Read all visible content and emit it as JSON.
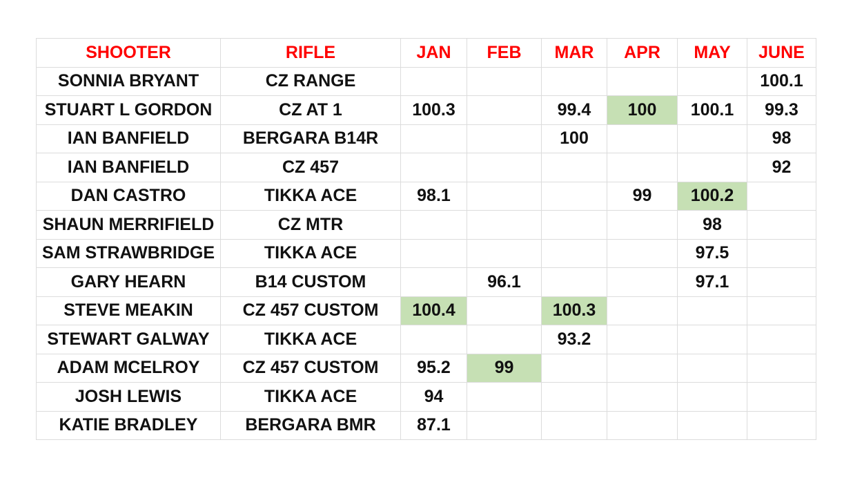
{
  "colors": {
    "header_text": "#ff0000",
    "highlight": "#c6e0b4",
    "grid": "#dcdcdc"
  },
  "headers": [
    "SHOOTER",
    "RIFLE",
    "JAN",
    "FEB",
    "MAR",
    "APR",
    "MAY",
    "JUNE"
  ],
  "rows": [
    {
      "shooter": "SONNIA BRYANT",
      "rifle": "CZ RANGE",
      "scores": [
        "",
        "",
        "",
        "",
        "",
        "100.1"
      ],
      "highlight": []
    },
    {
      "shooter": "STUART L GORDON",
      "rifle": "CZ AT 1",
      "scores": [
        "100.3",
        "",
        "99.4",
        "100",
        "100.1",
        "99.3"
      ],
      "highlight": [
        3
      ]
    },
    {
      "shooter": "IAN BANFIELD",
      "rifle": "BERGARA B14R",
      "scores": [
        "",
        "",
        "100",
        "",
        "",
        "98"
      ],
      "highlight": []
    },
    {
      "shooter": "IAN BANFIELD",
      "rifle": "CZ 457",
      "scores": [
        "",
        "",
        "",
        "",
        "",
        "92"
      ],
      "highlight": []
    },
    {
      "shooter": "DAN CASTRO",
      "rifle": "TIKKA ACE",
      "scores": [
        "98.1",
        "",
        "",
        "99",
        "100.2",
        ""
      ],
      "highlight": [
        4
      ]
    },
    {
      "shooter": "SHAUN MERRIFIELD",
      "rifle": "CZ MTR",
      "scores": [
        "",
        "",
        "",
        "",
        "98",
        ""
      ],
      "highlight": []
    },
    {
      "shooter": "SAM STRAWBRIDGE",
      "rifle": "TIKKA ACE",
      "scores": [
        "",
        "",
        "",
        "",
        "97.5",
        ""
      ],
      "highlight": []
    },
    {
      "shooter": "GARY HEARN",
      "rifle": "B14 CUSTOM",
      "scores": [
        "",
        "96.1",
        "",
        "",
        "97.1",
        ""
      ],
      "highlight": []
    },
    {
      "shooter": "STEVE MEAKIN",
      "rifle": "CZ 457 CUSTOM",
      "scores": [
        "100.4",
        "",
        "100.3",
        "",
        "",
        ""
      ],
      "highlight": [
        0,
        2
      ]
    },
    {
      "shooter": "STEWART GALWAY",
      "rifle": "TIKKA ACE",
      "scores": [
        "",
        "",
        "93.2",
        "",
        "",
        ""
      ],
      "highlight": []
    },
    {
      "shooter": "ADAM MCELROY",
      "rifle": "CZ 457 CUSTOM",
      "scores": [
        "95.2",
        "99",
        "",
        "",
        "",
        ""
      ],
      "highlight": [
        1
      ]
    },
    {
      "shooter": "JOSH LEWIS",
      "rifle": "TIKKA ACE",
      "scores": [
        "94",
        "",
        "",
        "",
        "",
        ""
      ],
      "highlight": []
    },
    {
      "shooter": "KATIE BRADLEY",
      "rifle": "BERGARA BMR",
      "scores": [
        "87.1",
        "",
        "",
        "",
        "",
        ""
      ],
      "highlight": []
    }
  ]
}
